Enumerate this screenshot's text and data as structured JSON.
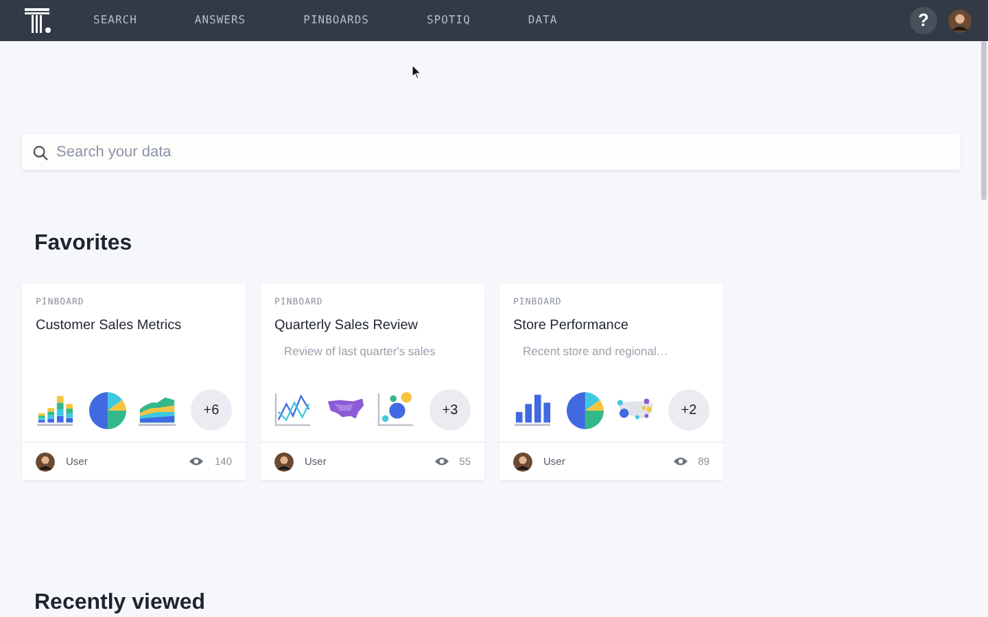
{
  "nav": {
    "items": [
      {
        "label": "SEARCH",
        "selected": false
      },
      {
        "label": "ANSWERS",
        "selected": false
      },
      {
        "label": "PINBOARDS",
        "selected": false
      },
      {
        "label": "SPOTIQ",
        "selected": false
      },
      {
        "label": "DATA",
        "selected": false
      }
    ],
    "help": "?"
  },
  "search": {
    "placeholder": "Search your data"
  },
  "favorites": {
    "title": "Favorites",
    "cards": [
      {
        "type": "PINBOARD",
        "title": "Customer Sales Metrics",
        "thumbs": [
          {
            "kind": "stacked-bar"
          },
          {
            "kind": "pie"
          },
          {
            "kind": "area"
          }
        ],
        "more": "+6",
        "user": "User",
        "views": "140"
      },
      {
        "type": "PINBOARD",
        "title": "Quarterly Sales Review",
        "description": "Review of last quarter's sales",
        "thumbs": [
          {
            "kind": "line"
          },
          {
            "kind": "map"
          },
          {
            "kind": "bubble"
          }
        ],
        "more": "+3",
        "user": "User",
        "views": "55"
      },
      {
        "type": "PINBOARD",
        "title": "Store Performance",
        "description": "Recent store and regional…",
        "thumbs": [
          {
            "kind": "bar"
          },
          {
            "kind": "pie"
          },
          {
            "kind": "dot-map"
          }
        ],
        "more": "+2",
        "user": "User",
        "views": "89"
      }
    ]
  },
  "recent": {
    "title": "Recently viewed"
  }
}
